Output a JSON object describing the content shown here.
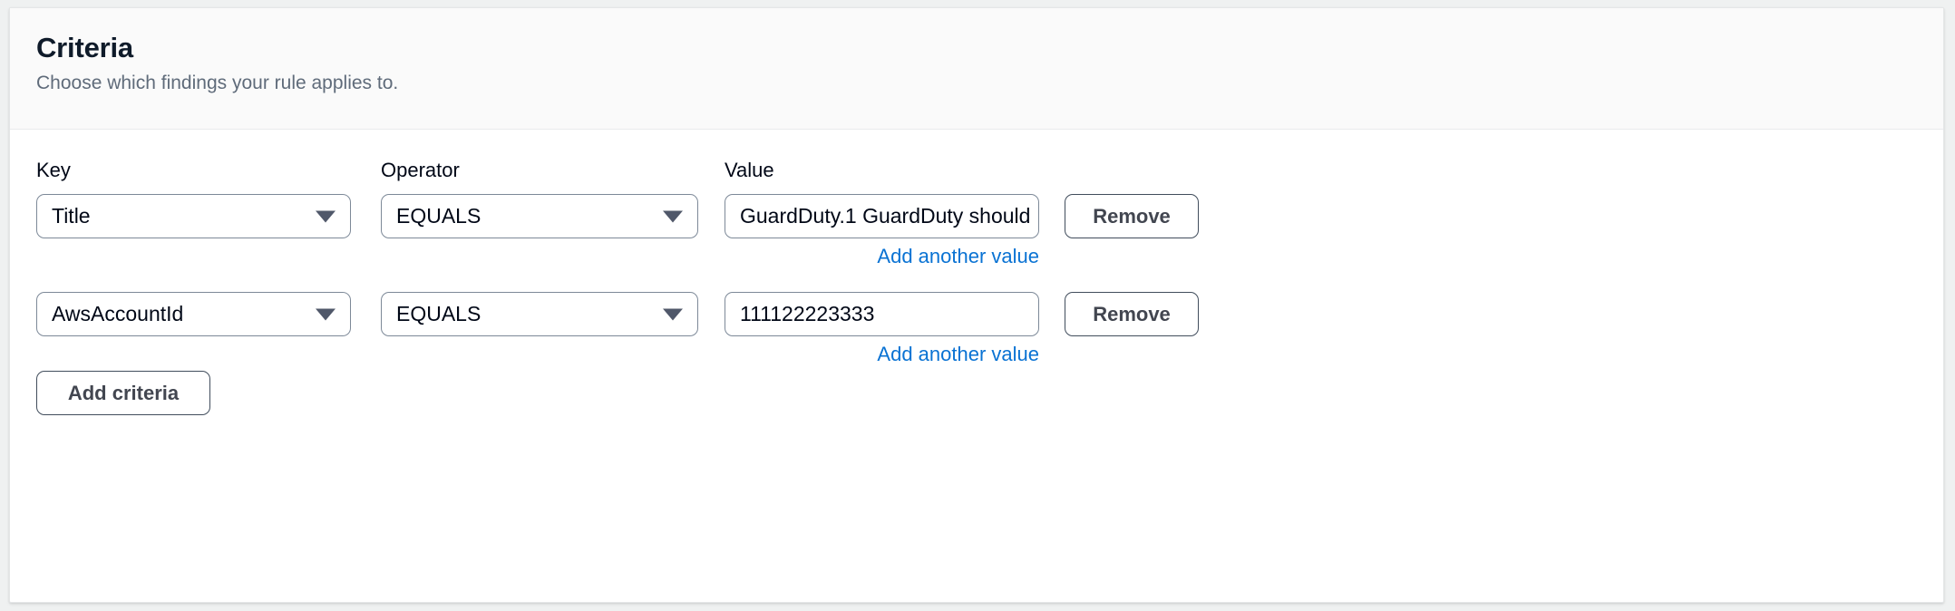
{
  "section": {
    "title": "Criteria",
    "description": "Choose which findings your rule applies to."
  },
  "columns": {
    "key_label": "Key",
    "operator_label": "Operator",
    "value_label": "Value"
  },
  "rows": [
    {
      "key": "Title",
      "operator": "EQUALS",
      "value": "GuardDuty.1 GuardDuty should",
      "remove_label": "Remove",
      "add_value_link": "Add another value"
    },
    {
      "key": "AwsAccountId",
      "operator": "EQUALS",
      "value": "111122223333",
      "remove_label": "Remove",
      "add_value_link": "Add another value"
    }
  ],
  "add_criteria_label": "Add criteria",
  "colors": {
    "link_blue": "#0972d3",
    "field_border": "#7d8998",
    "button_border": "#414d5c",
    "header_background": "#fafafa",
    "page_background": "#eff1f1"
  }
}
